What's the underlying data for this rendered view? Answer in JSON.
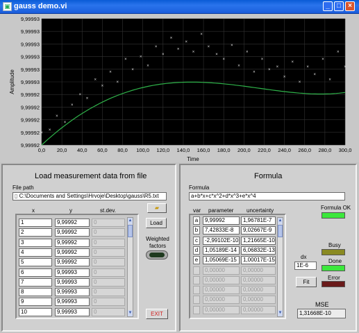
{
  "window": {
    "title": "gauss demo.vi",
    "icon": "labview-vi-icon",
    "controls": [
      "_",
      "□",
      "×"
    ]
  },
  "colors": {
    "plot_bg": "#000000",
    "fit_line": "#2fb34a",
    "points": "#e0e0e0",
    "led_ok": "#3ce83c",
    "led_busy": "#8a8a22",
    "led_error": "#6a1a1a"
  },
  "chart_data": {
    "type": "scatter",
    "xlabel": "Time",
    "ylabel": "Amplitude",
    "xlim": [
      0,
      300
    ],
    "ylim": [
      9.99992,
      9.99993
    ],
    "xticks": [
      "0,0",
      "20,0",
      "40,0",
      "60,0",
      "80,0",
      "100,0",
      "120,0",
      "140,0",
      "160,0",
      "180,0",
      "200,0",
      "220,0",
      "240,0",
      "260,0",
      "280,0",
      "300,0"
    ],
    "yticks": [
      "9,99993",
      "9,99993",
      "9,99993",
      "9,99993",
      "9,99993",
      "9,99993",
      "9,99992",
      "9,99992",
      "9,99992",
      "9,99992",
      "9,99992"
    ],
    "grid": true,
    "fit_params": [
      9.99992,
      7.42833e-08,
      -2.99102e-10,
      1.05189e-14,
      1.05069e-15
    ],
    "points_t": [
      0,
      8,
      15,
      23,
      30,
      38,
      45,
      53,
      60,
      68,
      75,
      83,
      90,
      98,
      105,
      113,
      120,
      128,
      135,
      143,
      150,
      158,
      165,
      173,
      180,
      188,
      195,
      203,
      210,
      218,
      225,
      233,
      240,
      248,
      255,
      263,
      270,
      278,
      285,
      293,
      300
    ],
    "points_y": [
      9.999921,
      9.9999212,
      9.9999223,
      9.9999218,
      9.9999232,
      9.999924,
      9.9999237,
      9.9999252,
      9.9999247,
      9.9999258,
      9.999925,
      9.9999268,
      9.999926,
      9.999927,
      9.9999263,
      9.9999278,
      9.9999272,
      9.9999285,
      9.9999276,
      9.9999282,
      9.9999274,
      9.9999288,
      9.9999278,
      9.9999272,
      9.9999268,
      9.9999279,
      9.9999263,
      9.9999274,
      9.9999258,
      9.9999268,
      9.999926,
      9.9999262,
      9.9999254,
      9.9999266,
      9.999925,
      9.9999262,
      9.9999256,
      9.9999268,
      9.9999252,
      9.9999274,
      9.9999262
    ]
  },
  "load": {
    "title": "Load measurement data from file",
    "file_path_label": "File path",
    "file_path": "C:\\Documents and Settings\\Hrvoje\\Desktop\\gauss\\R5.txt",
    "columns": [
      "x",
      "y",
      "st.dev."
    ],
    "rows": [
      [
        "1",
        "9,99992",
        "0"
      ],
      [
        "2",
        "9,99992",
        "0"
      ],
      [
        "3",
        "9,99992",
        "0"
      ],
      [
        "4",
        "9,99992",
        "0"
      ],
      [
        "5",
        "9,99992",
        "0"
      ],
      [
        "6",
        "9,99993",
        "0"
      ],
      [
        "7",
        "9,99993",
        "0"
      ],
      [
        "8",
        "9,99993",
        "0"
      ],
      [
        "9",
        "9,99993",
        "0"
      ],
      [
        "10",
        "9,99993",
        "0"
      ]
    ],
    "load_button": "Load",
    "weighted_label": "Weighted factors",
    "exit_button": "EXIT"
  },
  "formula": {
    "title": "Formula",
    "formula_label": "Formula",
    "formula_value": "a+b*x+c*x^2+d*x^3+e*x^4",
    "columns": [
      "var",
      "parameter",
      "uncertainty"
    ],
    "rows": [
      [
        "a",
        "9,99992",
        "1,96781E-7"
      ],
      [
        "b",
        "7,42833E-8",
        "9,02667E-9"
      ],
      [
        "c",
        "-2,99102E-10",
        "1,21665E-10"
      ],
      [
        "d",
        "1,05189E-14",
        "6,06832E-13"
      ],
      [
        "e",
        "1,05069E-15",
        "1,00017E-15"
      ]
    ],
    "empty_rows": [
      [
        "",
        "0,00000",
        "0,00000"
      ],
      [
        "",
        "0,00000",
        "0,00000"
      ],
      [
        "",
        "0,00000",
        "0,00000"
      ],
      [
        "",
        "0,00000",
        "0,00000"
      ],
      [
        "",
        "0,00000",
        "0,00000"
      ]
    ],
    "formula_ok_label": "Formula OK",
    "dx_label": "dx",
    "dx_value": "1E-6",
    "busy_label": "Busy",
    "done_label": "Done",
    "error_label": "Error",
    "fit_button": "Fit",
    "mse_label": "MSE",
    "mse_value": "1,31668E-10"
  }
}
